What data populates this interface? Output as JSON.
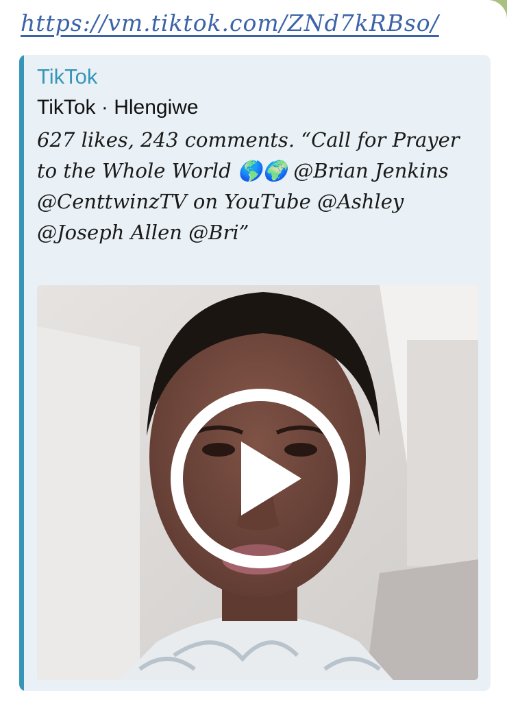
{
  "message": {
    "url": "https://vm.tiktok.com/ZNd7kRBso/"
  },
  "preview": {
    "site_name": "TikTok",
    "title": "TikTok · Hlengiwe",
    "description": "627 likes, 243 comments. “Call for Prayer to the Whole World 🌎🌍 @Brian Jenkins @CenttwinzTV on YouTube @Ashley @Joseph Allen @Bri”"
  },
  "icons": {
    "play": "play-icon"
  },
  "colors": {
    "accent": "#3796b8",
    "link": "#3a63a8",
    "card_background": "#e9f1f6",
    "chat_background": "#a9c07f"
  }
}
